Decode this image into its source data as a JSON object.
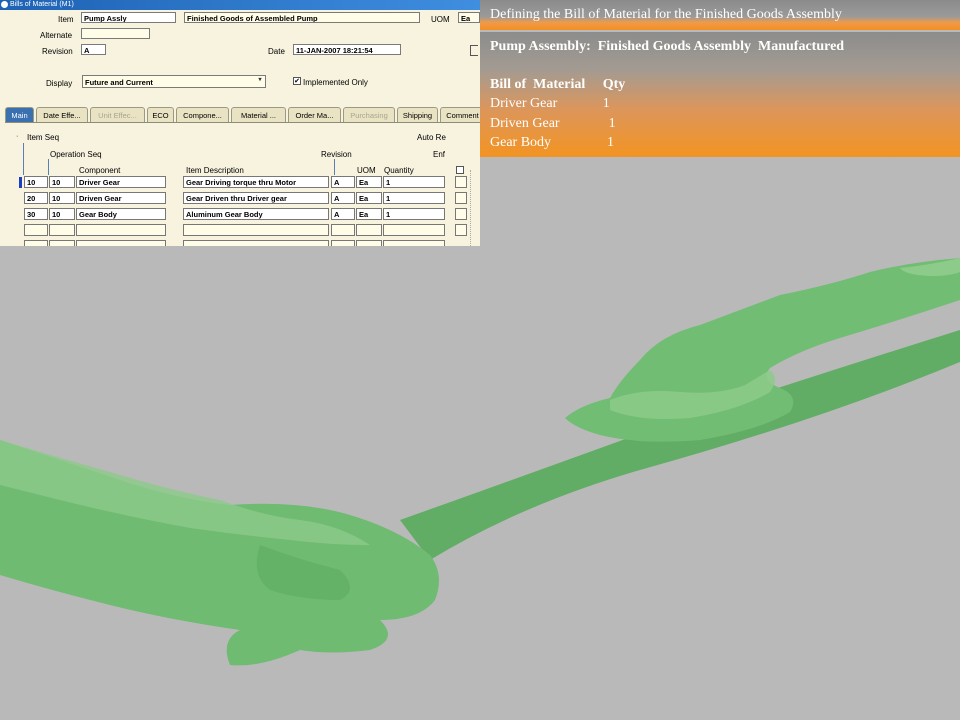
{
  "window": {
    "title": "Bills of Material (M1)"
  },
  "header_fields": {
    "item_label": "Item",
    "item_value": "Pump Assly",
    "item_description": "Finished Goods of Assembled Pump",
    "uom_label": "UOM",
    "uom_value": "Ea",
    "alternate_label": "Alternate",
    "revision_label": "Revision",
    "revision_value": "A",
    "date_label": "Date",
    "date_value": "11-JAN-2007 18:21:54",
    "display_label": "Display",
    "display_value": "Future and Current",
    "implemented_only_label": "Implemented Only",
    "implemented_only_checked": true
  },
  "tabs": [
    {
      "label": "Main",
      "state": "active"
    },
    {
      "label": "Date Effe...",
      "state": "normal"
    },
    {
      "label": "Unit Effec...",
      "state": "disabled"
    },
    {
      "label": "ECO",
      "state": "normal"
    },
    {
      "label": "Compone...",
      "state": "normal"
    },
    {
      "label": "Material ...",
      "state": "normal"
    },
    {
      "label": "Order Ma...",
      "state": "normal"
    },
    {
      "label": "Purchasing",
      "state": "disabled"
    },
    {
      "label": "Shipping",
      "state": "normal"
    },
    {
      "label": "Comment",
      "state": "normal"
    }
  ],
  "grid": {
    "headers": {
      "item_seq": "Item Seq",
      "operation_seq": "Operation Seq",
      "component": "Component",
      "item_description": "Item Description",
      "revision": "Revision",
      "uom": "UOM",
      "quantity": "Quantity",
      "auto_request": "Auto Re",
      "enforce": "Enf"
    },
    "rows": [
      {
        "item_seq": "10",
        "op_seq": "10",
        "component": "Driver Gear",
        "description": "Gear Driving torque thru Motor",
        "revision": "A",
        "uom": "Ea",
        "quantity": "1"
      },
      {
        "item_seq": "20",
        "op_seq": "10",
        "component": "Driven Gear",
        "description": "Gear Driven thru Driver gear",
        "revision": "A",
        "uom": "Ea",
        "quantity": "1"
      },
      {
        "item_seq": "30",
        "op_seq": "10",
        "component": "Gear Body",
        "description": "Aluminum Gear Body",
        "revision": "A",
        "uom": "Ea",
        "quantity": "1"
      }
    ]
  },
  "slide": {
    "header_title": "Defining the Bill of  Material for the Finished Goods Assembly",
    "assembly_line": "Pump Assembly:  Finished Goods Assembly  Manufactured",
    "bom_header": "Bill of  Material     Qty",
    "bom_lines": [
      "Driver Gear             1",
      "Driven Gear              1",
      "Gear Body                1"
    ]
  },
  "colors": {
    "orange_accent": "#f39020",
    "form_background": "#f7f3df",
    "hand_green": "#6ab86d",
    "slide_background": "#b9b9b9"
  }
}
